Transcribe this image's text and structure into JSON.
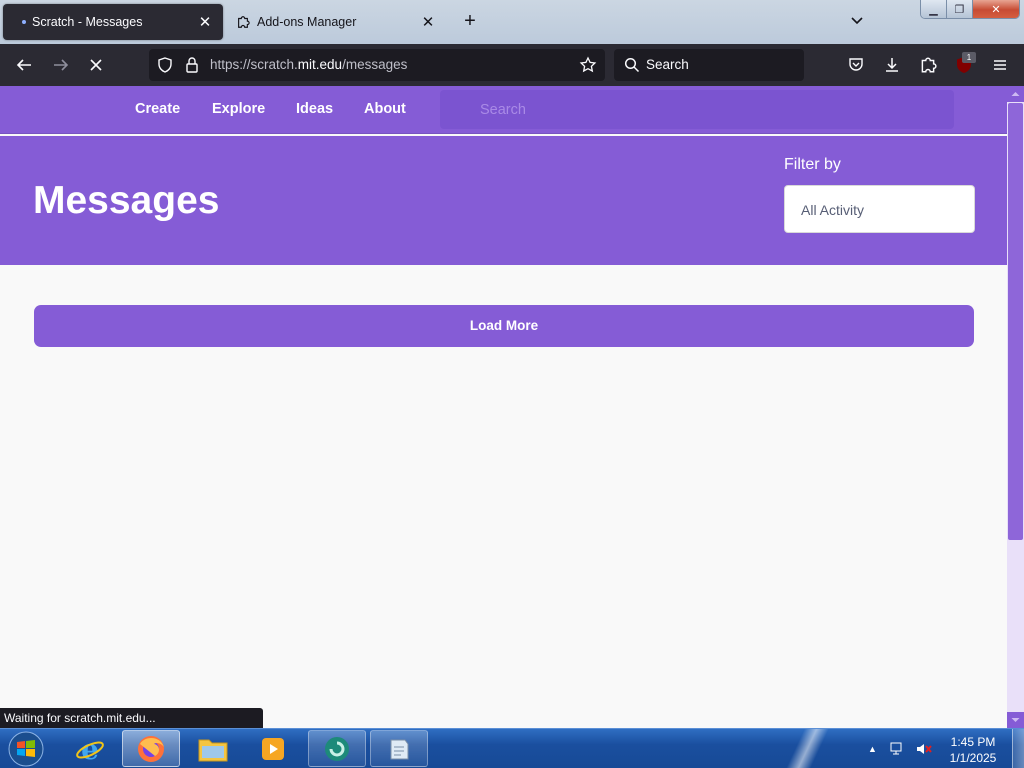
{
  "browser": {
    "tabs": [
      {
        "title": "Scratch - Messages",
        "active": true
      },
      {
        "title": "Add-ons Manager",
        "active": false
      }
    ],
    "url_prefix": "https://scratch.",
    "url_domain": "mit.edu",
    "url_path": "/messages",
    "search_placeholder": "Search",
    "extension_badge": "1",
    "status_text": "Waiting for scratch.mit.edu..."
  },
  "scratch_nav": {
    "links": [
      "Create",
      "Explore",
      "Ideas",
      "About"
    ],
    "search_placeholder": "Search"
  },
  "banner": {
    "title": "Messages",
    "filter_label": "Filter by",
    "filter_value": "All Activity"
  },
  "load_more_label": "Load More",
  "taskbar": {
    "time": "1:45 PM",
    "date": "1/1/2025"
  },
  "colors": {
    "scratch_purple": "#855cd6",
    "browser_dark": "#2b2a33",
    "taskbar_blue": "#1a4f9f"
  }
}
